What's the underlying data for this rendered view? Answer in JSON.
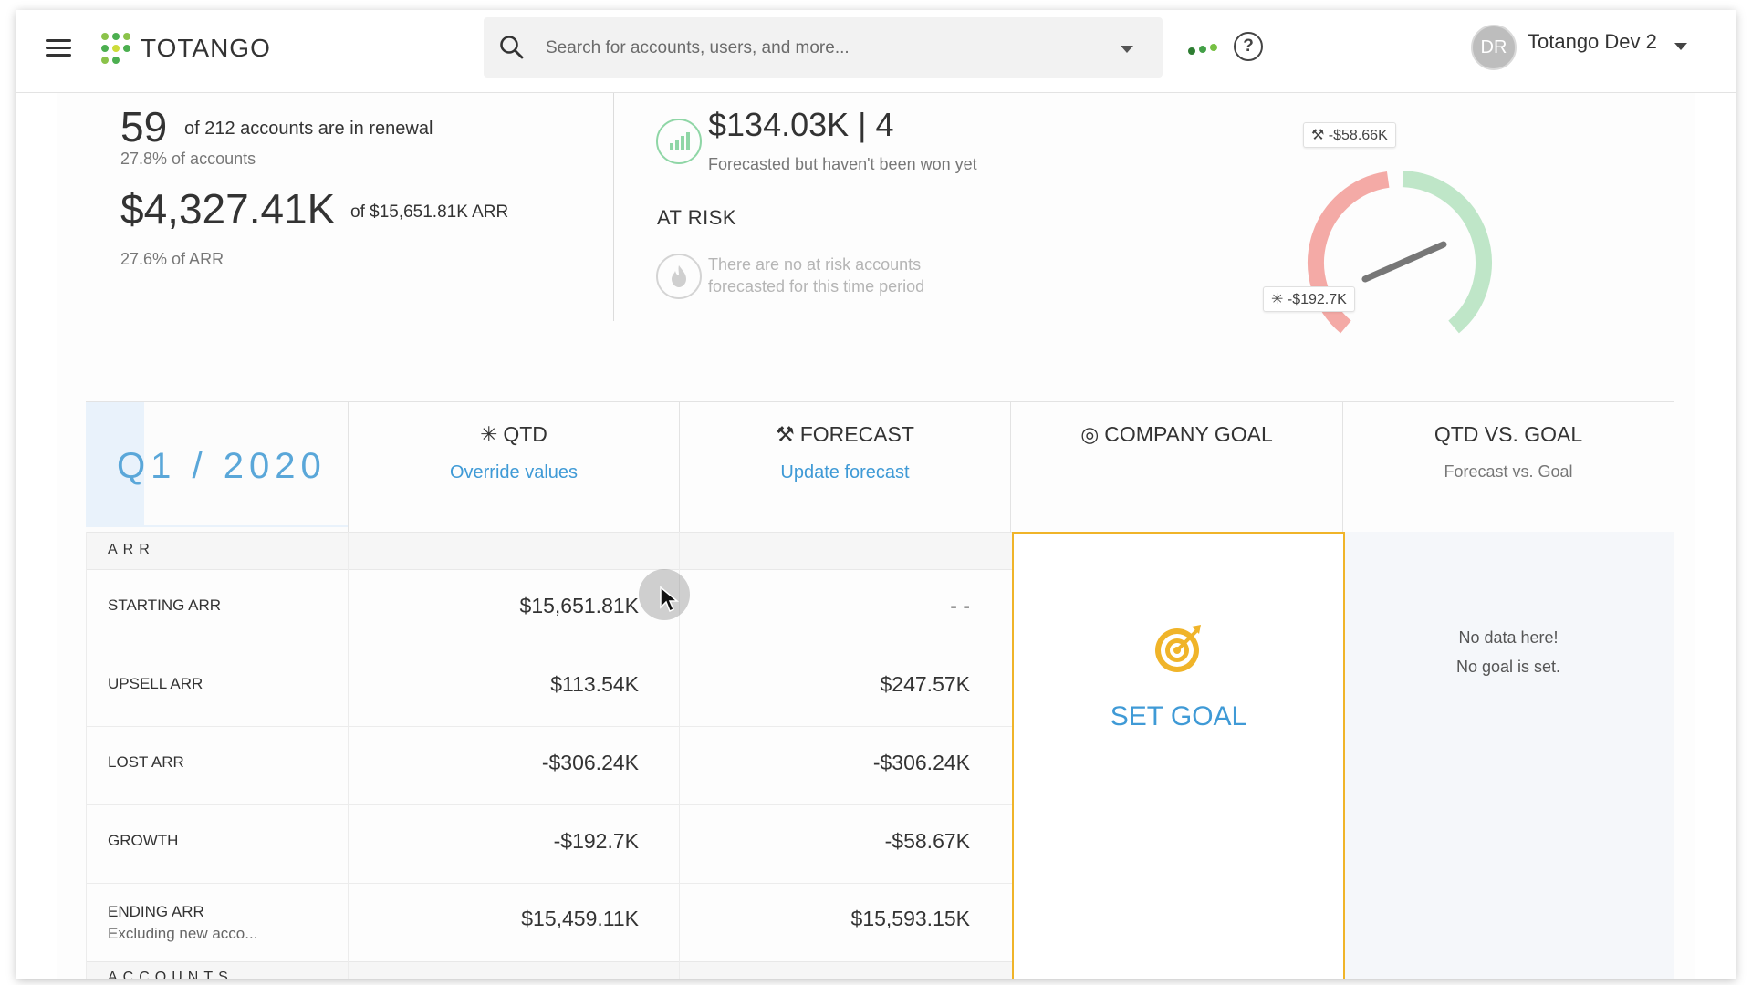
{
  "header": {
    "brand": "TOTANGO",
    "search_placeholder": "Search for accounts, users, and more...",
    "user_initials": "DR",
    "user_name": "Totango Dev 2",
    "help_glyph": "?"
  },
  "renewal": {
    "count": "59",
    "count_text": "of 212 accounts are in renewal",
    "count_pct": "27.8% of accounts",
    "arr": "$4,327.41K",
    "arr_text": "of $15,651.81K ARR",
    "arr_pct": "27.6% of ARR"
  },
  "forecast_summary": {
    "value": "$134.03K | 4",
    "note": "Forecasted but haven't been won yet",
    "at_risk_title": "AT RISK",
    "at_risk_note": "There are no at risk accounts forecasted for this time period"
  },
  "gauge": {
    "forecast_tag": "-$58.66K",
    "qtd_tag": "-$192.7K",
    "colors": {
      "low": "#f4aaa6",
      "high": "#bfe6c8",
      "needle": "#777777"
    }
  },
  "table": {
    "quarter": "Q1 / 2020",
    "columns": {
      "qtd": {
        "title": "QTD",
        "link": "Override values",
        "icon": "asterisk-icon"
      },
      "forecast": {
        "title": "FORECAST",
        "link": "Update forecast",
        "icon": "telescope-icon"
      },
      "goal": {
        "title": "COMPANY GOAL",
        "icon": "target-icon"
      },
      "qtd_vs_goal": {
        "title": "QTD VS. GOAL",
        "sub": "Forecast vs. Goal"
      }
    },
    "section_arr": "ARR",
    "section_accounts": "ACCOUNTS",
    "rows": [
      {
        "label": "STARTING ARR",
        "sub": "",
        "qtd": "$15,651.81K",
        "forecast": "- -"
      },
      {
        "label": "UPSELL ARR",
        "sub": "",
        "qtd": "$113.54K",
        "forecast": "$247.57K"
      },
      {
        "label": "LOST ARR",
        "sub": "",
        "qtd": "-$306.24K",
        "forecast": "-$306.24K"
      },
      {
        "label": "GROWTH",
        "sub": "",
        "qtd": "-$192.7K",
        "forecast": "-$58.67K"
      },
      {
        "label": "ENDING ARR",
        "sub": "Excluding new acco...",
        "qtd": "$15,459.11K",
        "forecast": "$15,593.15K"
      }
    ],
    "set_goal": "SET GOAL",
    "no_data_1": "No data here!",
    "no_data_2": "No goal is set."
  },
  "colors": {
    "accent": "#3f9ad6",
    "goal_border": "#f0b429",
    "brand_green": "#6cc04a"
  }
}
